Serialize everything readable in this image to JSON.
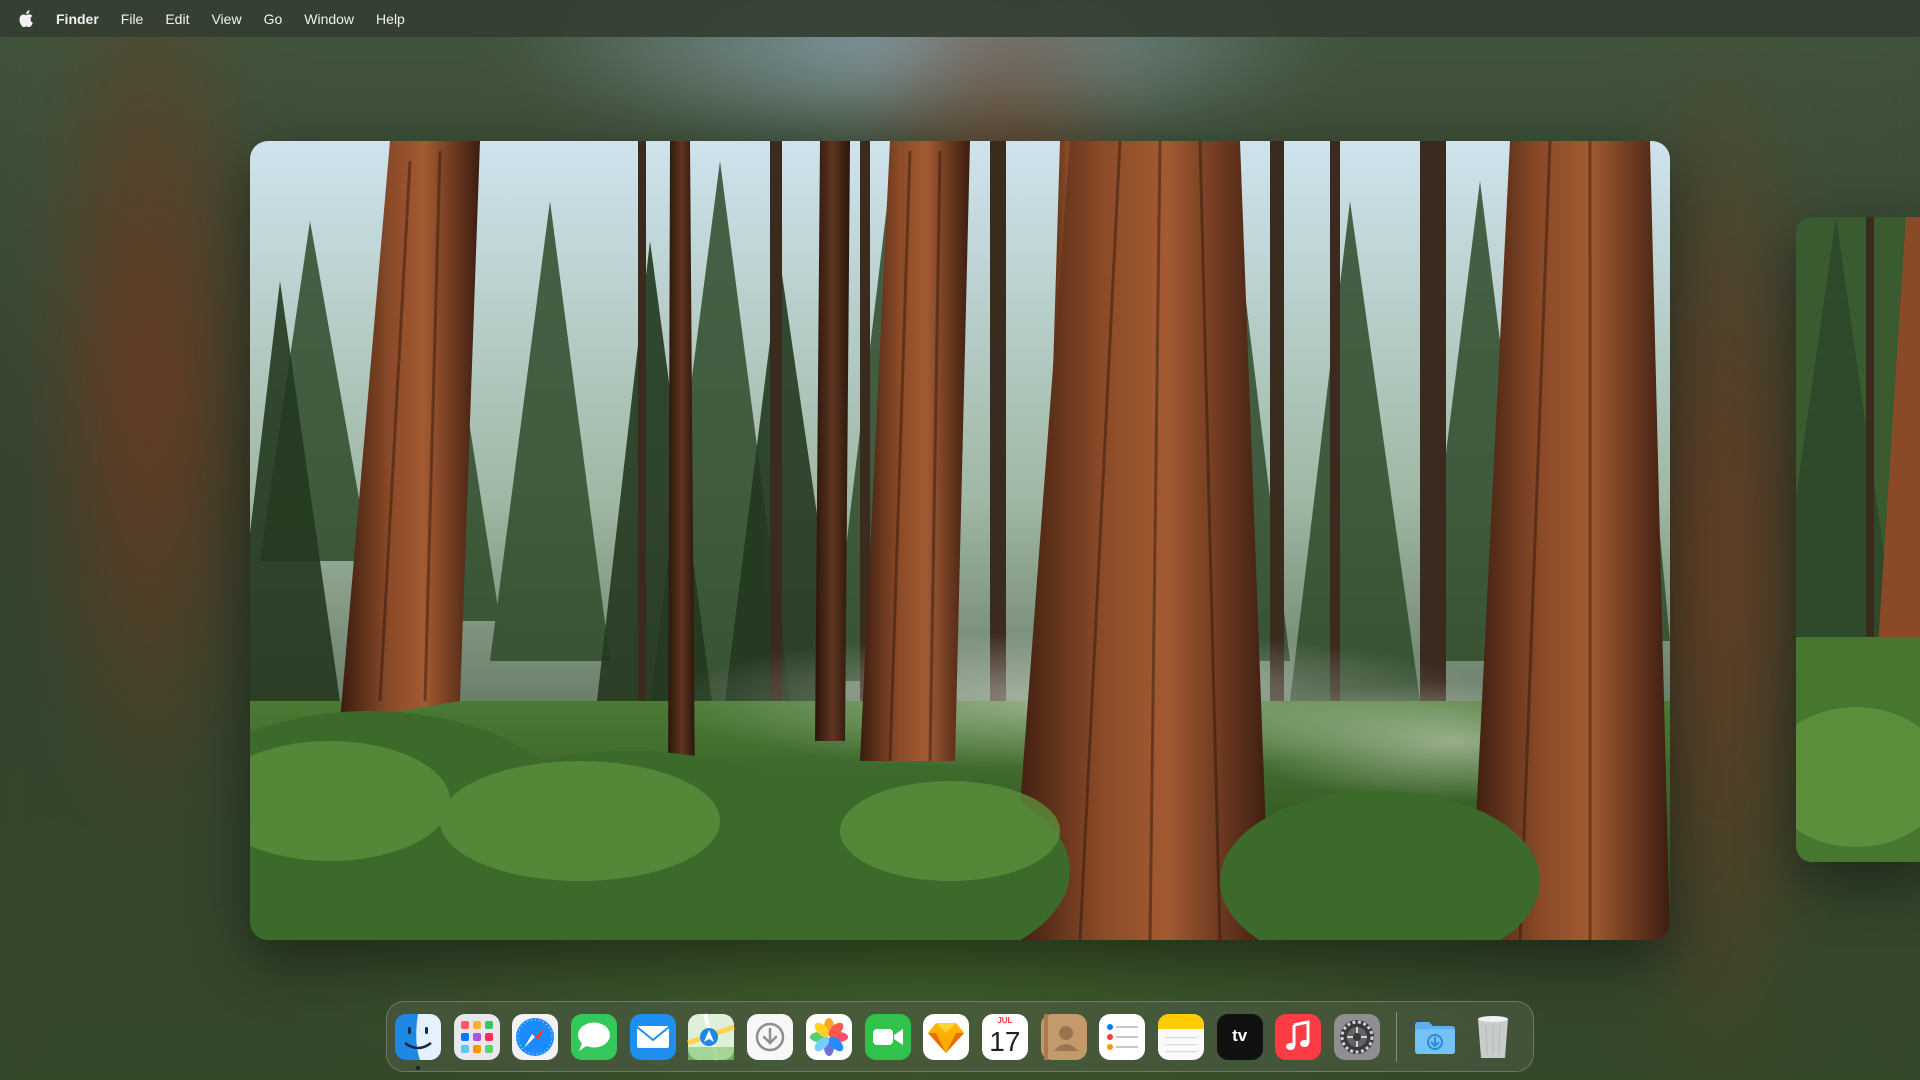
{
  "menubar": {
    "apple_icon": "apple-logo-icon",
    "app_name": "Finder",
    "items": [
      "File",
      "Edit",
      "View",
      "Go",
      "Window",
      "Help"
    ]
  },
  "wallpaper": {
    "subject": "sequoia-forest",
    "preview_count": 2
  },
  "dock": {
    "apps": [
      {
        "name": "Finder",
        "icon": "finder-icon",
        "running": true
      },
      {
        "name": "Launchpad",
        "icon": "launchpad-icon",
        "running": false
      },
      {
        "name": "Safari",
        "icon": "safari-icon",
        "running": false
      },
      {
        "name": "Messages",
        "icon": "messages-icon",
        "running": false
      },
      {
        "name": "Mail",
        "icon": "mail-icon",
        "running": false
      },
      {
        "name": "Maps",
        "icon": "maps-icon",
        "running": false
      },
      {
        "name": "Downloads Manager",
        "icon": "download-circle-icon",
        "running": false
      },
      {
        "name": "Photos",
        "icon": "photos-icon",
        "running": false
      },
      {
        "name": "FaceTime",
        "icon": "facetime-icon",
        "running": false
      },
      {
        "name": "Sketch",
        "icon": "sketch-icon",
        "running": false
      },
      {
        "name": "Calendar",
        "icon": "calendar-icon",
        "running": false
      },
      {
        "name": "Contacts",
        "icon": "contacts-icon",
        "running": false
      },
      {
        "name": "Reminders",
        "icon": "reminders-icon",
        "running": false
      },
      {
        "name": "Notes",
        "icon": "notes-icon",
        "running": false
      },
      {
        "name": "TV",
        "icon": "apple-tv-icon",
        "running": false
      },
      {
        "name": "Music",
        "icon": "music-icon",
        "running": false
      },
      {
        "name": "System Settings",
        "icon": "settings-gear-icon",
        "running": false
      }
    ],
    "calendar_month": "JUL",
    "calendar_day": "17",
    "tv_label": "tv",
    "stack_items": [
      {
        "name": "Downloads",
        "icon": "downloads-folder-icon"
      },
      {
        "name": "Trash",
        "icon": "trash-icon"
      }
    ]
  },
  "colors": {
    "menubar_bg": "#343e32",
    "menubar_text": "#f2f2f2",
    "bark": "#7a3f22",
    "foliage": "#3c6a2a",
    "sky": "#cfe3ee"
  }
}
